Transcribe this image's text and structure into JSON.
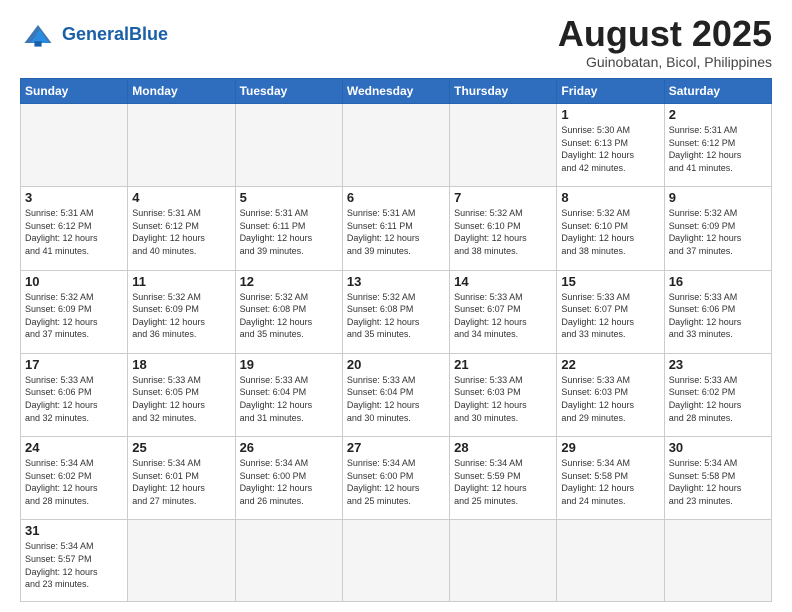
{
  "header": {
    "logo_text_normal": "General",
    "logo_text_bold": "Blue",
    "month_title": "August 2025",
    "subtitle": "Guinobatan, Bicol, Philippines"
  },
  "days_of_week": [
    "Sunday",
    "Monday",
    "Tuesday",
    "Wednesday",
    "Thursday",
    "Friday",
    "Saturday"
  ],
  "weeks": [
    [
      {
        "num": "",
        "info": ""
      },
      {
        "num": "",
        "info": ""
      },
      {
        "num": "",
        "info": ""
      },
      {
        "num": "",
        "info": ""
      },
      {
        "num": "",
        "info": ""
      },
      {
        "num": "1",
        "info": "Sunrise: 5:30 AM\nSunset: 6:13 PM\nDaylight: 12 hours\nand 42 minutes."
      },
      {
        "num": "2",
        "info": "Sunrise: 5:31 AM\nSunset: 6:12 PM\nDaylight: 12 hours\nand 41 minutes."
      }
    ],
    [
      {
        "num": "3",
        "info": "Sunrise: 5:31 AM\nSunset: 6:12 PM\nDaylight: 12 hours\nand 41 minutes."
      },
      {
        "num": "4",
        "info": "Sunrise: 5:31 AM\nSunset: 6:12 PM\nDaylight: 12 hours\nand 40 minutes."
      },
      {
        "num": "5",
        "info": "Sunrise: 5:31 AM\nSunset: 6:11 PM\nDaylight: 12 hours\nand 39 minutes."
      },
      {
        "num": "6",
        "info": "Sunrise: 5:31 AM\nSunset: 6:11 PM\nDaylight: 12 hours\nand 39 minutes."
      },
      {
        "num": "7",
        "info": "Sunrise: 5:32 AM\nSunset: 6:10 PM\nDaylight: 12 hours\nand 38 minutes."
      },
      {
        "num": "8",
        "info": "Sunrise: 5:32 AM\nSunset: 6:10 PM\nDaylight: 12 hours\nand 38 minutes."
      },
      {
        "num": "9",
        "info": "Sunrise: 5:32 AM\nSunset: 6:09 PM\nDaylight: 12 hours\nand 37 minutes."
      }
    ],
    [
      {
        "num": "10",
        "info": "Sunrise: 5:32 AM\nSunset: 6:09 PM\nDaylight: 12 hours\nand 37 minutes."
      },
      {
        "num": "11",
        "info": "Sunrise: 5:32 AM\nSunset: 6:09 PM\nDaylight: 12 hours\nand 36 minutes."
      },
      {
        "num": "12",
        "info": "Sunrise: 5:32 AM\nSunset: 6:08 PM\nDaylight: 12 hours\nand 35 minutes."
      },
      {
        "num": "13",
        "info": "Sunrise: 5:32 AM\nSunset: 6:08 PM\nDaylight: 12 hours\nand 35 minutes."
      },
      {
        "num": "14",
        "info": "Sunrise: 5:33 AM\nSunset: 6:07 PM\nDaylight: 12 hours\nand 34 minutes."
      },
      {
        "num": "15",
        "info": "Sunrise: 5:33 AM\nSunset: 6:07 PM\nDaylight: 12 hours\nand 33 minutes."
      },
      {
        "num": "16",
        "info": "Sunrise: 5:33 AM\nSunset: 6:06 PM\nDaylight: 12 hours\nand 33 minutes."
      }
    ],
    [
      {
        "num": "17",
        "info": "Sunrise: 5:33 AM\nSunset: 6:06 PM\nDaylight: 12 hours\nand 32 minutes."
      },
      {
        "num": "18",
        "info": "Sunrise: 5:33 AM\nSunset: 6:05 PM\nDaylight: 12 hours\nand 32 minutes."
      },
      {
        "num": "19",
        "info": "Sunrise: 5:33 AM\nSunset: 6:04 PM\nDaylight: 12 hours\nand 31 minutes."
      },
      {
        "num": "20",
        "info": "Sunrise: 5:33 AM\nSunset: 6:04 PM\nDaylight: 12 hours\nand 30 minutes."
      },
      {
        "num": "21",
        "info": "Sunrise: 5:33 AM\nSunset: 6:03 PM\nDaylight: 12 hours\nand 30 minutes."
      },
      {
        "num": "22",
        "info": "Sunrise: 5:33 AM\nSunset: 6:03 PM\nDaylight: 12 hours\nand 29 minutes."
      },
      {
        "num": "23",
        "info": "Sunrise: 5:33 AM\nSunset: 6:02 PM\nDaylight: 12 hours\nand 28 minutes."
      }
    ],
    [
      {
        "num": "24",
        "info": "Sunrise: 5:34 AM\nSunset: 6:02 PM\nDaylight: 12 hours\nand 28 minutes."
      },
      {
        "num": "25",
        "info": "Sunrise: 5:34 AM\nSunset: 6:01 PM\nDaylight: 12 hours\nand 27 minutes."
      },
      {
        "num": "26",
        "info": "Sunrise: 5:34 AM\nSunset: 6:00 PM\nDaylight: 12 hours\nand 26 minutes."
      },
      {
        "num": "27",
        "info": "Sunrise: 5:34 AM\nSunset: 6:00 PM\nDaylight: 12 hours\nand 25 minutes."
      },
      {
        "num": "28",
        "info": "Sunrise: 5:34 AM\nSunset: 5:59 PM\nDaylight: 12 hours\nand 25 minutes."
      },
      {
        "num": "29",
        "info": "Sunrise: 5:34 AM\nSunset: 5:58 PM\nDaylight: 12 hours\nand 24 minutes."
      },
      {
        "num": "30",
        "info": "Sunrise: 5:34 AM\nSunset: 5:58 PM\nDaylight: 12 hours\nand 23 minutes."
      }
    ],
    [
      {
        "num": "31",
        "info": "Sunrise: 5:34 AM\nSunset: 5:57 PM\nDaylight: 12 hours\nand 23 minutes."
      },
      {
        "num": "",
        "info": ""
      },
      {
        "num": "",
        "info": ""
      },
      {
        "num": "",
        "info": ""
      },
      {
        "num": "",
        "info": ""
      },
      {
        "num": "",
        "info": ""
      },
      {
        "num": "",
        "info": ""
      }
    ]
  ]
}
